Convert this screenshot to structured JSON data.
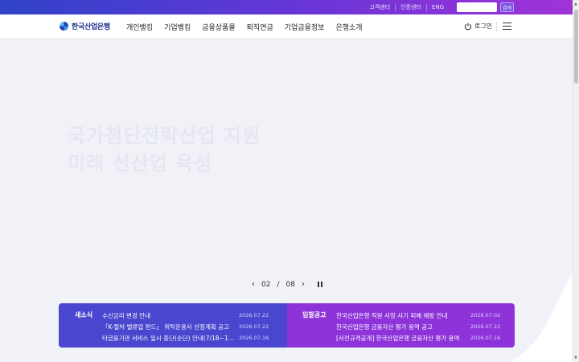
{
  "util": {
    "links": [
      "고객센터",
      "인증센터",
      "ENG"
    ],
    "search_placeholder": "",
    "search_button": "검색"
  },
  "nav": {
    "logo": "한국산업은행",
    "menu": [
      "개인뱅킹",
      "기업뱅킹",
      "금융상품몰",
      "퇴직연금",
      "기업금융정보",
      "은행소개"
    ],
    "login": "로그인"
  },
  "hero": {
    "title_line1": "국가첨단전략산업 지원",
    "title_line2": "미래 신산업 육성",
    "pager_current": "02",
    "pager_sep": "/",
    "pager_total": "08"
  },
  "news": {
    "heading": "새소식",
    "items": [
      {
        "title": "수신금리 변경 안내",
        "date": "2026.07.22"
      },
      {
        "title": "「K-펄처 밸류업 펀드」 위탁운용사 선정계획 공고",
        "date": "2026.07.22"
      },
      {
        "title": "타금융기관 서비스 일시 중단(순단) 안내(7/18~1…",
        "date": "2026.07.16"
      }
    ]
  },
  "bids": {
    "heading": "입찰공고",
    "items": [
      {
        "title": "한국산업은행 직원 사칭 사기 피해 예방 안내",
        "date": "2026.07.02"
      },
      {
        "title": "한국산업은행 금융자산 평가 용역 공고",
        "date": "2026.07.22"
      },
      {
        "title": "[사전규격공개] 한국산업은행 금융자산 평가 용역",
        "date": "2026.07.16"
      }
    ]
  }
}
